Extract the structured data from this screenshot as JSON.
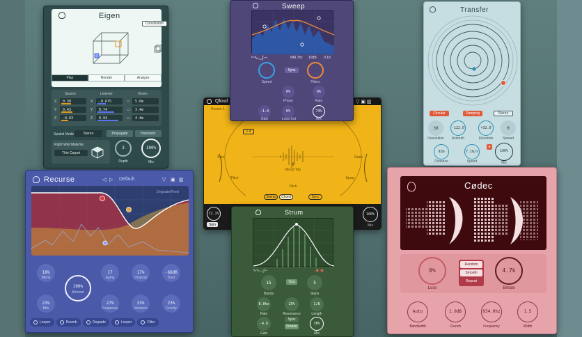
{
  "eigen": {
    "title": "Eigen",
    "convolution_label": "Convolution",
    "tabs": [
      "Play",
      "Render",
      "Analyze"
    ],
    "columns": [
      {
        "header": "Source",
        "rows": [
          {
            "axis": "X",
            "value": "0.38"
          },
          {
            "axis": "Y",
            "value": "0.43"
          },
          {
            "axis": "Z",
            "value": "-0.63"
          }
        ]
      },
      {
        "header": "Listener",
        "rows": [
          {
            "axis": "X",
            "value": "-0.675"
          },
          {
            "axis": "Y",
            "value": "0.74"
          },
          {
            "axis": "Z",
            "value": "0.94"
          }
        ]
      },
      {
        "header": "Room",
        "rows": [
          {
            "axis": "",
            "value": "5.0m"
          },
          {
            "axis": "",
            "value": "3.4m"
          },
          {
            "axis": "",
            "value": "4.4m"
          }
        ]
      }
    ],
    "spatial_mode_label": "Spatial Mode",
    "spatial_mode_value": "Stereo",
    "propagate_label": "Propagate",
    "harmonic_label": "Harmonic",
    "material_label": "Right Wall Material",
    "material_value": "Thin Carpet",
    "depth_label": "Depth",
    "depth_value": "3",
    "mix_label": "Mix",
    "mix_value": "100%"
  },
  "recurse": {
    "title": "Recurse",
    "preset": "Default",
    "plot_tag": "Degrade/Feed",
    "knobs": [
      {
        "value": "18%",
        "label": "Blend"
      },
      {
        "value": "17",
        "label": "Aging"
      },
      {
        "value": "17%",
        "label": "Dropout"
      },
      {
        "value": "-68dB",
        "label": "Dust"
      },
      {
        "value": "100%",
        "label": "Amount"
      },
      {
        "value": "23%",
        "label": "Bite"
      },
      {
        "value": "27%",
        "label": "Frequency"
      },
      {
        "value": "33%",
        "label": "Variance"
      },
      {
        "value": "23%",
        "label": "Gravity"
      }
    ],
    "chips": [
      "Looper",
      "Reverb",
      "Degrade",
      "Looper"
    ],
    "filter_label": "Filter"
  },
  "sweep": {
    "title": "Sweep",
    "readout": [
      "849.7hz",
      "10dB",
      "0.18"
    ],
    "speed_label": "Speed",
    "filters_label": "Filters",
    "sync_label": "Sync",
    "knobs": [
      {
        "value": "0%",
        "label": "Phase"
      },
      {
        "value": "0%",
        "label": "Rate"
      },
      {
        "value": "-1.4",
        "label": "Gain"
      },
      {
        "value": "0%",
        "label": "Loop Cut"
      },
      {
        "value": "73%",
        "label": "Mix"
      }
    ]
  },
  "qloud": {
    "title": "Qloud",
    "preset": "Kosmo 1",
    "knob_labels": [
      "Size",
      "Pitch",
      "Grain",
      "Spray"
    ],
    "grain_value": "1.4",
    "mode_buttons": [
      "Swing",
      "Chord",
      "Sync"
    ],
    "center_value": "0",
    "center_label": "Mood Tab",
    "pitch_label": "Pitch",
    "in_value": "72.1%",
    "out_label": "Spin",
    "mix_value": "100%",
    "mix_label": "Mix"
  },
  "strum": {
    "title": "Strum",
    "bands_value": "15",
    "bands_label": "Bands",
    "steps_value": "5",
    "steps_label": "Steps",
    "mode": "Cos",
    "knobs": [
      {
        "value": "8.0hz",
        "label": "Rate"
      },
      {
        "value": "25%",
        "label": "Resonance"
      },
      {
        "value": "1/8",
        "label": "Length"
      },
      {
        "value": "-4.6",
        "label": "Gain"
      },
      {
        "value": "78%",
        "label": "Mix"
      }
    ],
    "toggle_a": "Sync",
    "toggle_b": "Freeze"
  },
  "transfer": {
    "title": "Transfer",
    "buttons": [
      "Circular",
      "Damping",
      "Stereo"
    ],
    "row_knobs": [
      {
        "value": "30",
        "label": "Resolution"
      },
      {
        "value": "-122.0",
        "label": "Azimuth"
      },
      {
        "value": "+32.0",
        "label": "Elevation"
      },
      {
        "value": "0",
        "label": "Spread"
      }
    ],
    "bottom_knobs": [
      {
        "value": "92m",
        "label": "Distance"
      },
      {
        "value": "7.1m/s",
        "label": "Speed"
      },
      {
        "value": "100%",
        "label": "Mix"
      }
    ]
  },
  "codec": {
    "title": "Cødec",
    "loss_value": "0%",
    "loss_label": "Loss",
    "modes": [
      "Random",
      "Smooth",
      "Repeat"
    ],
    "bitrate_value": "4.7k",
    "bitrate_label": "Bitrate",
    "knobs": [
      {
        "value": "Auto",
        "label": "Bandwidth"
      },
      {
        "value": "1.9dB",
        "label": "Crunch"
      },
      {
        "value": "934.0hz",
        "label": "Frequency"
      },
      {
        "value": "1.5",
        "label": "Width"
      }
    ]
  }
}
